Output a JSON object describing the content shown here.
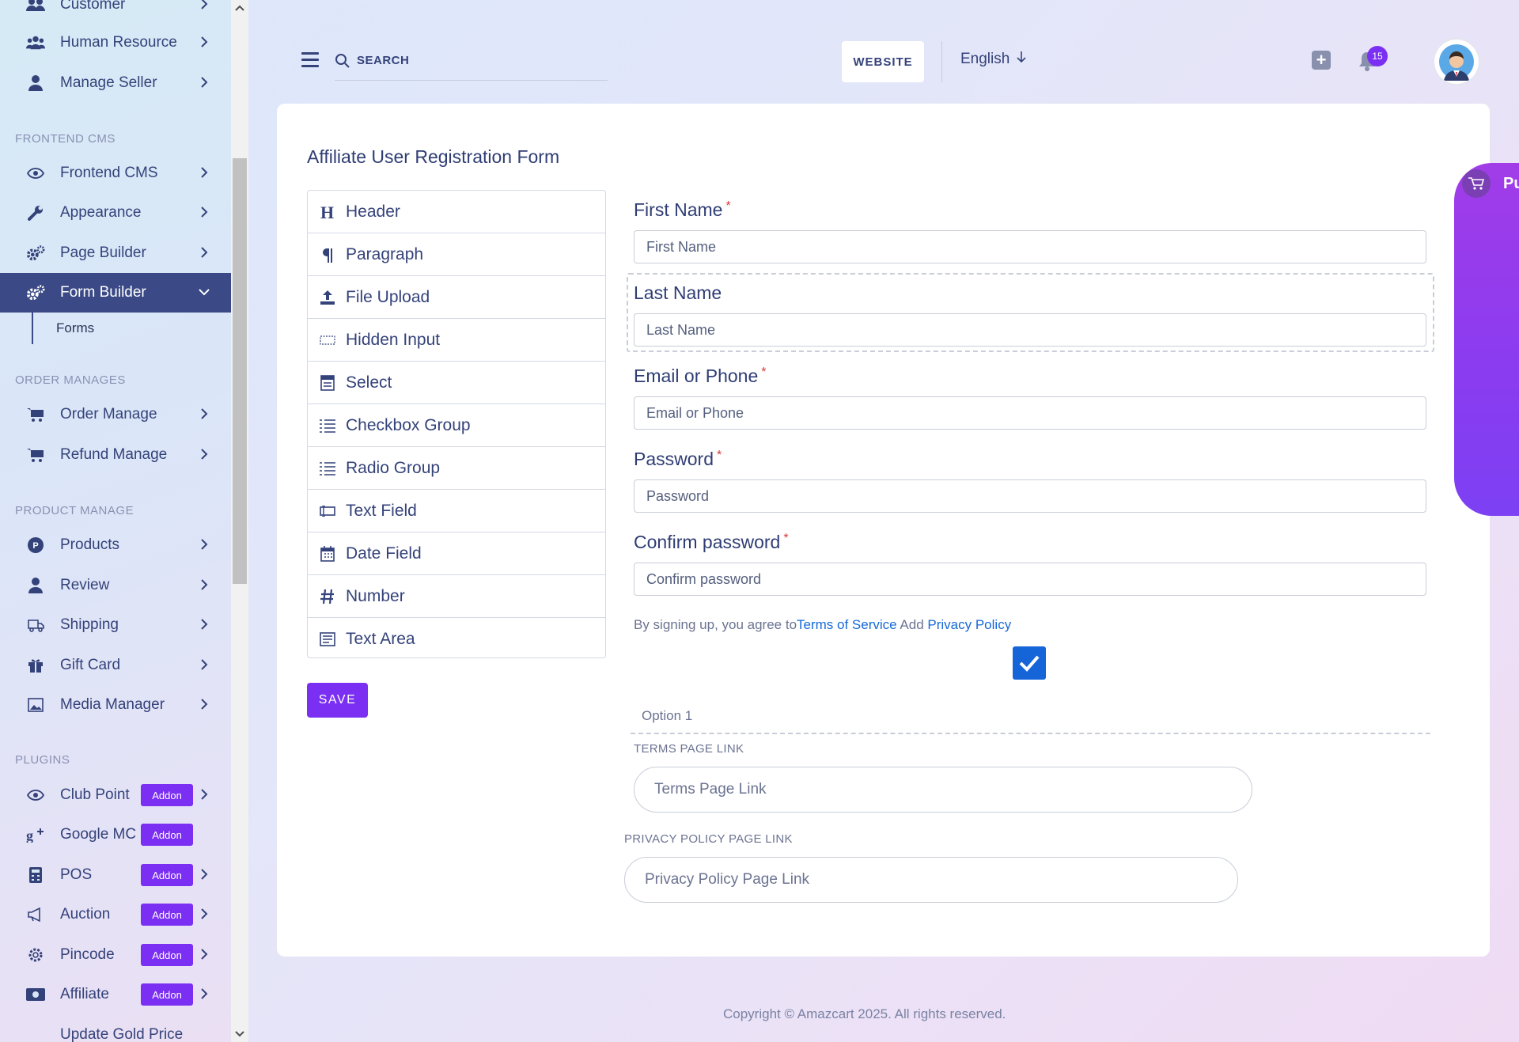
{
  "sidebar": {
    "items": {
      "customer": "Customer",
      "human_resource": "Human Resource",
      "manage_seller": "Manage Seller",
      "frontend_cms": "Frontend CMS",
      "appearance": "Appearance",
      "page_builder": "Page Builder",
      "form_builder": "Form Builder",
      "forms": "Forms",
      "order_manage": "Order Manage",
      "refund_manage": "Refund Manage",
      "products": "Products",
      "review": "Review",
      "shipping": "Shipping",
      "gift_card": "Gift Card",
      "media_manager": "Media Manager",
      "club_point": "Club Point",
      "google_mc": "Google MC",
      "pos": "POS",
      "auction": "Auction",
      "pincode": "Pincode",
      "affiliate": "Affiliate",
      "update_gold_price": "Update Gold Price"
    },
    "sections": {
      "frontend_cms": "FRONTEND CMS",
      "order_manages": "ORDER MANAGES",
      "product_manage": "PRODUCT MANAGE",
      "plugins": "PLUGINS"
    },
    "addon_label": "Addon"
  },
  "header": {
    "search_label": "SEARCH",
    "website_label": "WEBSITE",
    "language": "English",
    "notification_count": "15"
  },
  "form": {
    "title": "Affiliate User Registration Form",
    "palette": [
      "Header",
      "Paragraph",
      "File Upload",
      "Hidden Input",
      "Select",
      "Checkbox Group",
      "Radio Group",
      "Text Field",
      "Date Field",
      "Number",
      "Text Area"
    ],
    "save_label": "SAVE",
    "fields": {
      "first_name": {
        "label": "First Name",
        "placeholder": "First Name"
      },
      "last_name": {
        "label": "Last Name",
        "placeholder": "Last Name"
      },
      "email": {
        "label": "Email or Phone",
        "placeholder": "Email or Phone"
      },
      "password": {
        "label": "Password",
        "placeholder": "Password"
      },
      "confirm": {
        "label": "Confirm password",
        "placeholder": "Confirm password"
      }
    },
    "required_mark": "*",
    "agree": {
      "prefix": "By signing up, you agree to",
      "terms": "Terms of Service",
      "and": " Add ",
      "privacy": "Privacy Policy"
    },
    "option1": "Option 1",
    "terms_link": {
      "label": "TERMS PAGE LINK",
      "placeholder": "Terms Page Link"
    },
    "privacy_link": {
      "label": "PRIVACY POLICY PAGE LINK",
      "placeholder": "Privacy Policy Page Link"
    }
  },
  "side_panel": {
    "text": "Pu"
  },
  "footer": {
    "text": "Copyright © Amazcart 2025. All rights reserved."
  },
  "colors": {
    "accent": "#7a2ff2",
    "active_nav": "#3b4a86",
    "checkbox": "#1565d8",
    "link": "#1769d6"
  }
}
